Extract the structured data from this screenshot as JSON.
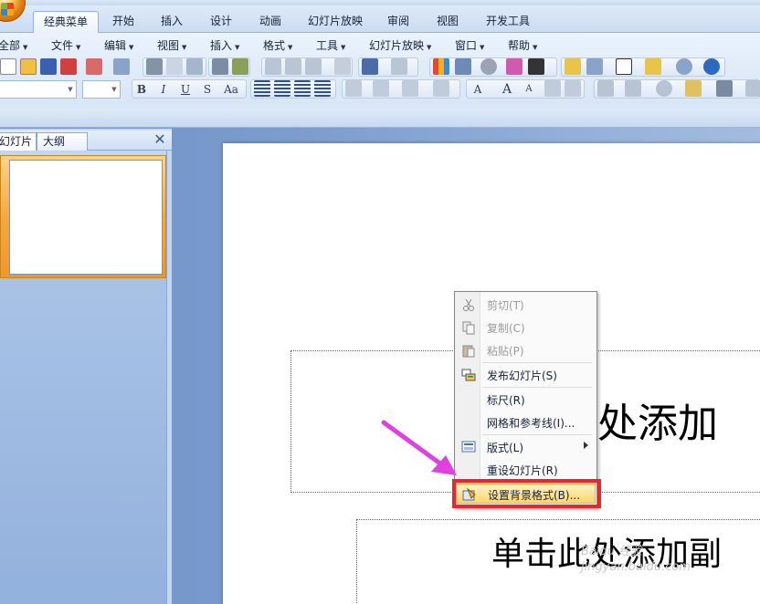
{
  "ribbon_tabs": [
    "经典菜单",
    "开始",
    "插入",
    "设计",
    "动画",
    "幻灯片放映",
    "审阅",
    "视图",
    "开发工具"
  ],
  "active_tab": "经典菜单",
  "menubar": [
    "全部",
    "文件",
    "编辑",
    "视图",
    "插入",
    "格式",
    "工具",
    "幻灯片放映",
    "窗口",
    "帮助"
  ],
  "format_buttons": {
    "bold": "B",
    "italic": "I",
    "underline": "U",
    "shadow": "S",
    "case": "Aa"
  },
  "left_pane": {
    "tabs": [
      "幻灯片",
      "大纲"
    ],
    "close_glyph": "✕",
    "slide_count": 1
  },
  "slide": {
    "title_placeholder": "单击此处添加标题",
    "title_visible": "此处添加",
    "subtitle_placeholder": "单击此处添加副标题",
    "subtitle_visible": "单击此处添加副"
  },
  "context_menu": {
    "items": [
      {
        "label": "剪切(T)",
        "icon": "scissors-icon",
        "disabled": true
      },
      {
        "label": "复制(C)",
        "icon": "copy-icon",
        "disabled": true
      },
      {
        "label": "粘贴(P)",
        "icon": "paste-icon",
        "disabled": true
      },
      {
        "label": "发布幻灯片(S)",
        "icon": "publish-slides-icon",
        "disabled": false
      },
      {
        "label": "标尺(R)",
        "icon": "",
        "disabled": false
      },
      {
        "label": "网格和参考线(I)...",
        "icon": "",
        "disabled": false
      },
      {
        "label": "版式(L)",
        "icon": "layout-icon",
        "disabled": false,
        "submenu": true
      },
      {
        "label": "重设幻灯片(R)",
        "icon": "",
        "disabled": false
      },
      {
        "label": "设置背景格式(B)...",
        "icon": "format-background-icon",
        "disabled": false,
        "highlighted": true
      }
    ]
  },
  "annotation": {
    "highlight_color": "#e8272b",
    "arrow_color": "#e040e0"
  },
  "watermark": {
    "line1": "Baidu 经验",
    "line2": "jingyan.baidu.com"
  }
}
